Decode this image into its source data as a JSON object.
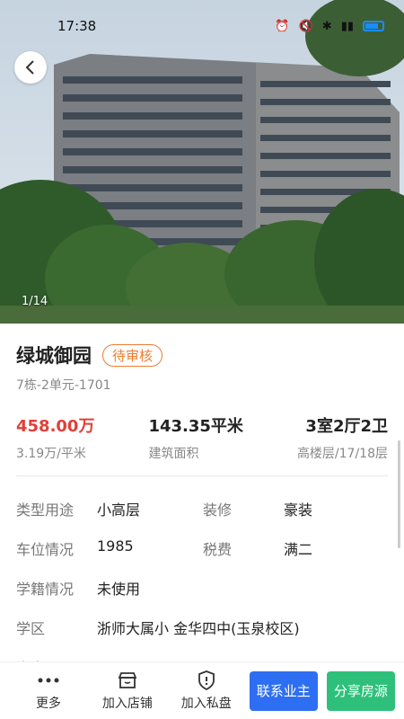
{
  "status_bar": {
    "time": "17:38"
  },
  "photo": {
    "index": "1/14"
  },
  "listing": {
    "name": "绿城御园",
    "status_badge": "待审核",
    "unit": "7栋-2单元-1701",
    "price": "458.00万",
    "unit_price": "3.19万/平米",
    "area": "143.35平米",
    "area_label": "建筑面积",
    "layout": "3室2厅2卫",
    "floor": "高楼层/17/18层"
  },
  "details": {
    "type_label": "类型用途",
    "type_value": "小高层",
    "decoration_label": "装修",
    "decoration_value": "豪装",
    "parking_label": "车位情况",
    "parking_value": "1985",
    "tax_label": "税费",
    "tax_value": "满二",
    "school_status_label": "学籍情况",
    "school_status_value": "未使用",
    "district_label": "学区",
    "district_value": "浙师大属小 金华四中(玉泉校区)",
    "highlights_label": "卖点"
  },
  "bottom_bar": {
    "more": "更多",
    "add_shop": "加入店铺",
    "add_private": "加入私盘",
    "contact_owner": "联系业主",
    "share": "分享房源"
  },
  "colors": {
    "price_red": "#e0403a",
    "badge_orange": "#ee7d2f",
    "blue": "#2e6ef2",
    "green": "#2ec07a"
  }
}
